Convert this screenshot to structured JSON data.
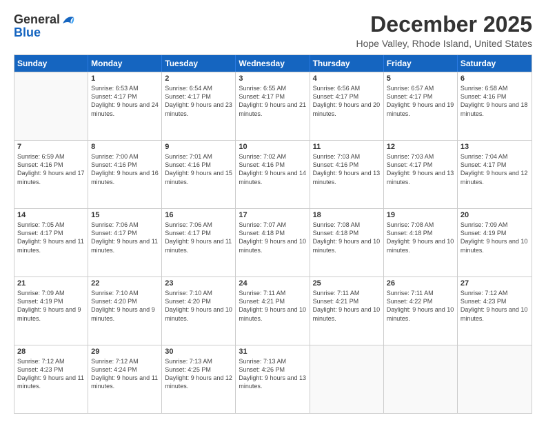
{
  "header": {
    "logo_general": "General",
    "logo_blue": "Blue",
    "title": "December 2025",
    "subtitle": "Hope Valley, Rhode Island, United States"
  },
  "days_of_week": [
    "Sunday",
    "Monday",
    "Tuesday",
    "Wednesday",
    "Thursday",
    "Friday",
    "Saturday"
  ],
  "weeks": [
    [
      {
        "day": "",
        "empty": true
      },
      {
        "day": "1",
        "sunrise": "Sunrise: 6:53 AM",
        "sunset": "Sunset: 4:17 PM",
        "daylight": "Daylight: 9 hours and 24 minutes."
      },
      {
        "day": "2",
        "sunrise": "Sunrise: 6:54 AM",
        "sunset": "Sunset: 4:17 PM",
        "daylight": "Daylight: 9 hours and 23 minutes."
      },
      {
        "day": "3",
        "sunrise": "Sunrise: 6:55 AM",
        "sunset": "Sunset: 4:17 PM",
        "daylight": "Daylight: 9 hours and 21 minutes."
      },
      {
        "day": "4",
        "sunrise": "Sunrise: 6:56 AM",
        "sunset": "Sunset: 4:17 PM",
        "daylight": "Daylight: 9 hours and 20 minutes."
      },
      {
        "day": "5",
        "sunrise": "Sunrise: 6:57 AM",
        "sunset": "Sunset: 4:17 PM",
        "daylight": "Daylight: 9 hours and 19 minutes."
      },
      {
        "day": "6",
        "sunrise": "Sunrise: 6:58 AM",
        "sunset": "Sunset: 4:16 PM",
        "daylight": "Daylight: 9 hours and 18 minutes."
      }
    ],
    [
      {
        "day": "7",
        "sunrise": "Sunrise: 6:59 AM",
        "sunset": "Sunset: 4:16 PM",
        "daylight": "Daylight: 9 hours and 17 minutes."
      },
      {
        "day": "8",
        "sunrise": "Sunrise: 7:00 AM",
        "sunset": "Sunset: 4:16 PM",
        "daylight": "Daylight: 9 hours and 16 minutes."
      },
      {
        "day": "9",
        "sunrise": "Sunrise: 7:01 AM",
        "sunset": "Sunset: 4:16 PM",
        "daylight": "Daylight: 9 hours and 15 minutes."
      },
      {
        "day": "10",
        "sunrise": "Sunrise: 7:02 AM",
        "sunset": "Sunset: 4:16 PM",
        "daylight": "Daylight: 9 hours and 14 minutes."
      },
      {
        "day": "11",
        "sunrise": "Sunrise: 7:03 AM",
        "sunset": "Sunset: 4:16 PM",
        "daylight": "Daylight: 9 hours and 13 minutes."
      },
      {
        "day": "12",
        "sunrise": "Sunrise: 7:03 AM",
        "sunset": "Sunset: 4:17 PM",
        "daylight": "Daylight: 9 hours and 13 minutes."
      },
      {
        "day": "13",
        "sunrise": "Sunrise: 7:04 AM",
        "sunset": "Sunset: 4:17 PM",
        "daylight": "Daylight: 9 hours and 12 minutes."
      }
    ],
    [
      {
        "day": "14",
        "sunrise": "Sunrise: 7:05 AM",
        "sunset": "Sunset: 4:17 PM",
        "daylight": "Daylight: 9 hours and 11 minutes."
      },
      {
        "day": "15",
        "sunrise": "Sunrise: 7:06 AM",
        "sunset": "Sunset: 4:17 PM",
        "daylight": "Daylight: 9 hours and 11 minutes."
      },
      {
        "day": "16",
        "sunrise": "Sunrise: 7:06 AM",
        "sunset": "Sunset: 4:17 PM",
        "daylight": "Daylight: 9 hours and 11 minutes."
      },
      {
        "day": "17",
        "sunrise": "Sunrise: 7:07 AM",
        "sunset": "Sunset: 4:18 PM",
        "daylight": "Daylight: 9 hours and 10 minutes."
      },
      {
        "day": "18",
        "sunrise": "Sunrise: 7:08 AM",
        "sunset": "Sunset: 4:18 PM",
        "daylight": "Daylight: 9 hours and 10 minutes."
      },
      {
        "day": "19",
        "sunrise": "Sunrise: 7:08 AM",
        "sunset": "Sunset: 4:18 PM",
        "daylight": "Daylight: 9 hours and 10 minutes."
      },
      {
        "day": "20",
        "sunrise": "Sunrise: 7:09 AM",
        "sunset": "Sunset: 4:19 PM",
        "daylight": "Daylight: 9 hours and 10 minutes."
      }
    ],
    [
      {
        "day": "21",
        "sunrise": "Sunrise: 7:09 AM",
        "sunset": "Sunset: 4:19 PM",
        "daylight": "Daylight: 9 hours and 9 minutes."
      },
      {
        "day": "22",
        "sunrise": "Sunrise: 7:10 AM",
        "sunset": "Sunset: 4:20 PM",
        "daylight": "Daylight: 9 hours and 9 minutes."
      },
      {
        "day": "23",
        "sunrise": "Sunrise: 7:10 AM",
        "sunset": "Sunset: 4:20 PM",
        "daylight": "Daylight: 9 hours and 10 minutes."
      },
      {
        "day": "24",
        "sunrise": "Sunrise: 7:11 AM",
        "sunset": "Sunset: 4:21 PM",
        "daylight": "Daylight: 9 hours and 10 minutes."
      },
      {
        "day": "25",
        "sunrise": "Sunrise: 7:11 AM",
        "sunset": "Sunset: 4:21 PM",
        "daylight": "Daylight: 9 hours and 10 minutes."
      },
      {
        "day": "26",
        "sunrise": "Sunrise: 7:11 AM",
        "sunset": "Sunset: 4:22 PM",
        "daylight": "Daylight: 9 hours and 10 minutes."
      },
      {
        "day": "27",
        "sunrise": "Sunrise: 7:12 AM",
        "sunset": "Sunset: 4:23 PM",
        "daylight": "Daylight: 9 hours and 10 minutes."
      }
    ],
    [
      {
        "day": "28",
        "sunrise": "Sunrise: 7:12 AM",
        "sunset": "Sunset: 4:23 PM",
        "daylight": "Daylight: 9 hours and 11 minutes."
      },
      {
        "day": "29",
        "sunrise": "Sunrise: 7:12 AM",
        "sunset": "Sunset: 4:24 PM",
        "daylight": "Daylight: 9 hours and 11 minutes."
      },
      {
        "day": "30",
        "sunrise": "Sunrise: 7:13 AM",
        "sunset": "Sunset: 4:25 PM",
        "daylight": "Daylight: 9 hours and 12 minutes."
      },
      {
        "day": "31",
        "sunrise": "Sunrise: 7:13 AM",
        "sunset": "Sunset: 4:26 PM",
        "daylight": "Daylight: 9 hours and 13 minutes."
      },
      {
        "day": "",
        "empty": true
      },
      {
        "day": "",
        "empty": true
      },
      {
        "day": "",
        "empty": true
      }
    ]
  ]
}
